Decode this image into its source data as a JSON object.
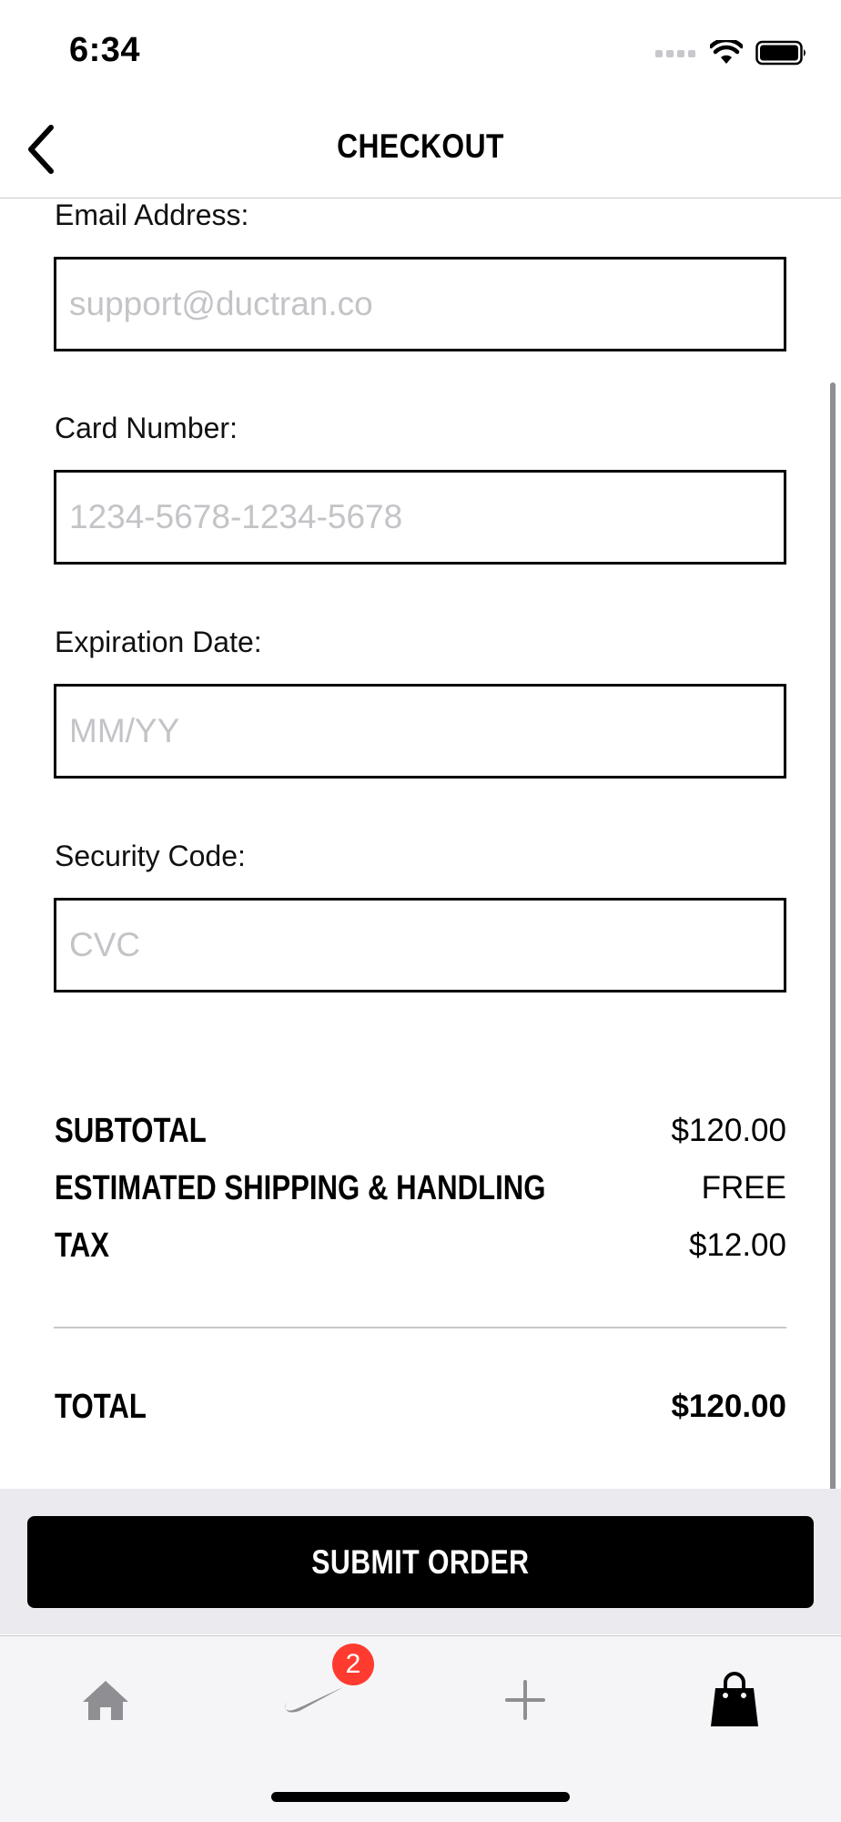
{
  "status_bar": {
    "time": "6:34"
  },
  "nav": {
    "title": "CHECKOUT",
    "back_icon": "chevron-left-icon"
  },
  "form": {
    "email": {
      "label": "Email Address:",
      "placeholder": "support@ductran.co",
      "value": ""
    },
    "card_number": {
      "label": "Card Number:",
      "placeholder": "1234-5678-1234-5678",
      "value": ""
    },
    "expiration": {
      "label": "Expiration Date:",
      "placeholder": "MM/YY",
      "value": ""
    },
    "security_code": {
      "label": "Security Code:",
      "placeholder": "CVC",
      "value": ""
    }
  },
  "summary": {
    "subtotal_label": "SUBTOTAL",
    "subtotal_value": "$120.00",
    "shipping_label": "ESTIMATED SHIPPING & HANDLING",
    "shipping_value": "FREE",
    "tax_label": "TAX",
    "tax_value": "$12.00",
    "total_label": "TOTAL",
    "total_value": "$120.00"
  },
  "actions": {
    "submit_label": "SUBMIT ORDER"
  },
  "tab_bar": {
    "tabs": [
      {
        "name": "home",
        "icon": "home-icon"
      },
      {
        "name": "favorites",
        "icon": "swoosh-icon",
        "badge": "2"
      },
      {
        "name": "add",
        "icon": "plus-icon"
      },
      {
        "name": "bag",
        "icon": "shopping-bag-icon",
        "selected": true
      }
    ]
  },
  "colors": {
    "badge": "#ff3b30",
    "button": "#000000",
    "placeholder": "#c4c4c8",
    "tab_inactive": "#8e8e93"
  }
}
